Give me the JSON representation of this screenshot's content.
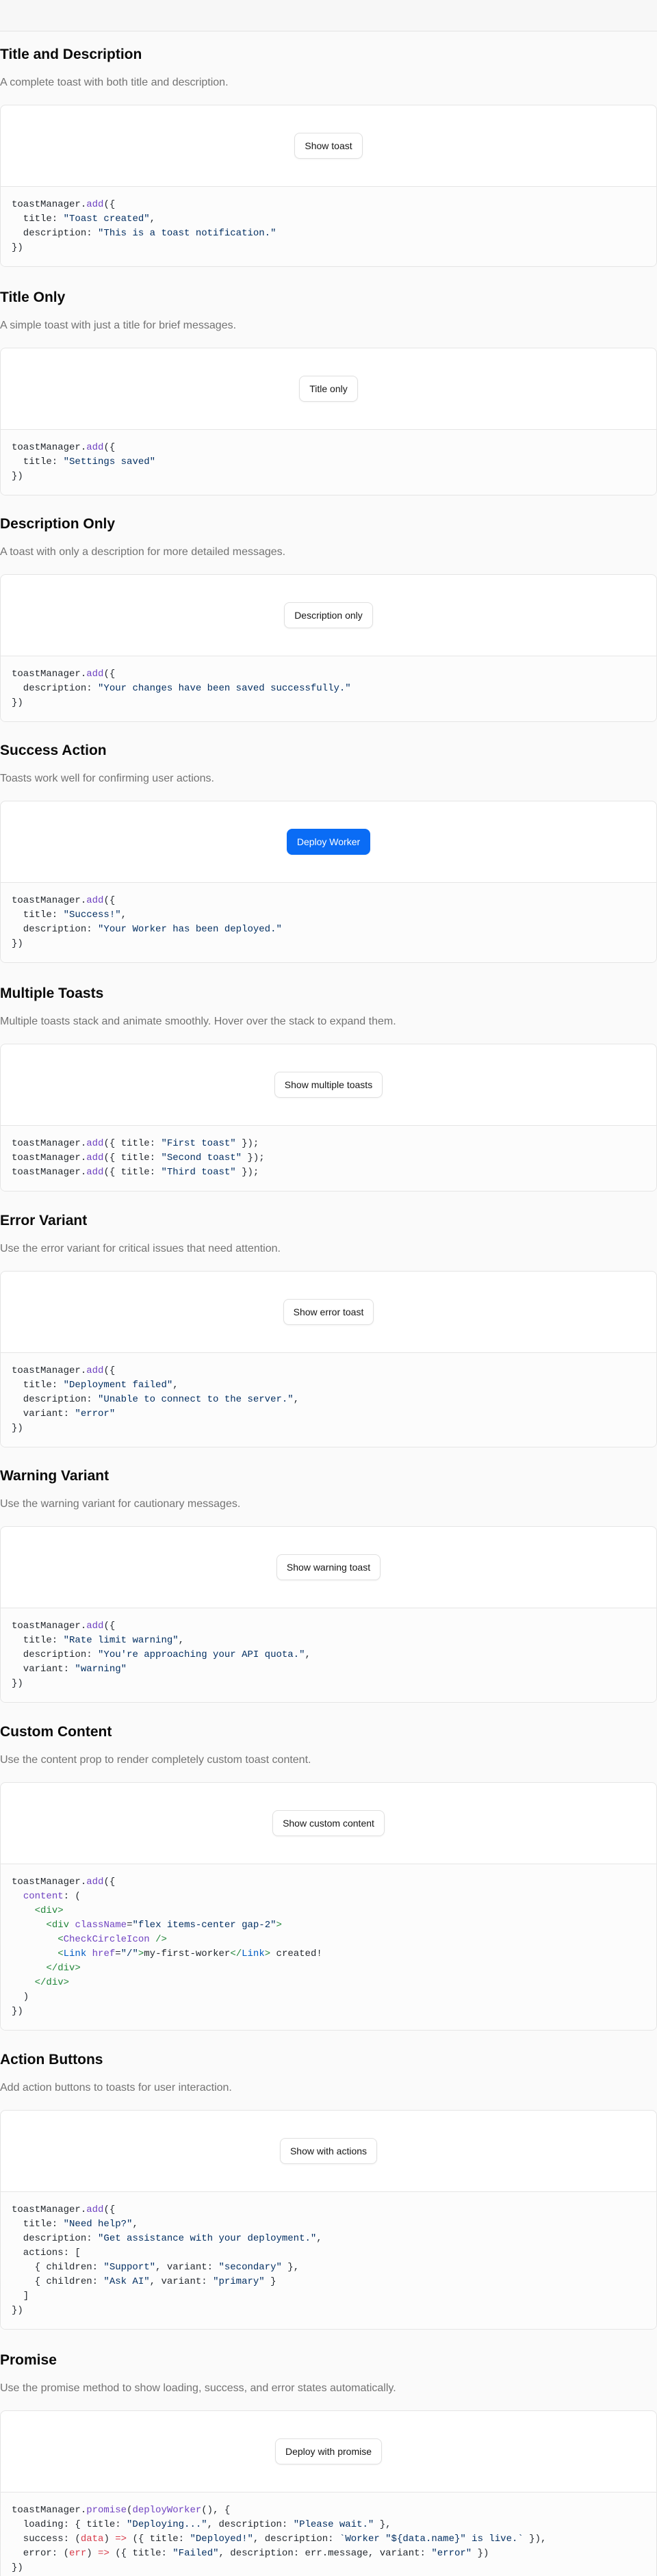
{
  "sections": [
    {
      "title": "Title and Description",
      "description": "A complete toast with both title and description.",
      "button": "Show toast",
      "primary": false,
      "code": [
        [
          [
            "plain",
            "toastManager."
          ],
          [
            "fn",
            "add"
          ],
          [
            "plain",
            "({"
          ]
        ],
        [
          [
            "plain",
            "  title: "
          ],
          [
            "str",
            "\"Toast created\""
          ],
          [
            "plain",
            ","
          ]
        ],
        [
          [
            "plain",
            "  description: "
          ],
          [
            "str",
            "\"This is a toast notification.\""
          ]
        ],
        [
          [
            "plain",
            "})"
          ]
        ]
      ]
    },
    {
      "title": "Title Only",
      "description": "A simple toast with just a title for brief messages.",
      "button": "Title only",
      "primary": false,
      "code": [
        [
          [
            "plain",
            "toastManager."
          ],
          [
            "fn",
            "add"
          ],
          [
            "plain",
            "({"
          ]
        ],
        [
          [
            "plain",
            "  title: "
          ],
          [
            "str",
            "\"Settings saved\""
          ]
        ],
        [
          [
            "plain",
            "})"
          ]
        ]
      ]
    },
    {
      "title": "Description Only",
      "description": "A toast with only a description for more detailed messages.",
      "button": "Description only",
      "primary": false,
      "code": [
        [
          [
            "plain",
            "toastManager."
          ],
          [
            "fn",
            "add"
          ],
          [
            "plain",
            "({"
          ]
        ],
        [
          [
            "plain",
            "  description: "
          ],
          [
            "str",
            "\"Your changes have been saved successfully.\""
          ]
        ],
        [
          [
            "plain",
            "})"
          ]
        ]
      ]
    },
    {
      "title": "Success Action",
      "description": "Toasts work well for confirming user actions.",
      "button": "Deploy Worker",
      "primary": true,
      "code": [
        [
          [
            "plain",
            "toastManager."
          ],
          [
            "fn",
            "add"
          ],
          [
            "plain",
            "({"
          ]
        ],
        [
          [
            "plain",
            "  title: "
          ],
          [
            "str",
            "\"Success!\""
          ],
          [
            "plain",
            ","
          ]
        ],
        [
          [
            "plain",
            "  description: "
          ],
          [
            "str",
            "\"Your Worker has been deployed.\""
          ]
        ],
        [
          [
            "plain",
            "})"
          ]
        ]
      ]
    },
    {
      "title": "Multiple Toasts",
      "description": "Multiple toasts stack and animate smoothly. Hover over the stack to expand them.",
      "button": "Show multiple toasts",
      "primary": false,
      "code": [
        [
          [
            "plain",
            "toastManager."
          ],
          [
            "fn",
            "add"
          ],
          [
            "plain",
            "({ title: "
          ],
          [
            "str",
            "\"First toast\""
          ],
          [
            "plain",
            " });"
          ]
        ],
        [
          [
            "plain",
            "toastManager."
          ],
          [
            "fn",
            "add"
          ],
          [
            "plain",
            "({ title: "
          ],
          [
            "str",
            "\"Second toast\""
          ],
          [
            "plain",
            " });"
          ]
        ],
        [
          [
            "plain",
            "toastManager."
          ],
          [
            "fn",
            "add"
          ],
          [
            "plain",
            "({ title: "
          ],
          [
            "str",
            "\"Third toast\""
          ],
          [
            "plain",
            " });"
          ]
        ]
      ]
    },
    {
      "title": "Error Variant",
      "description": "Use the error variant for critical issues that need attention.",
      "button": "Show error toast",
      "primary": false,
      "code": [
        [
          [
            "plain",
            "toastManager."
          ],
          [
            "fn",
            "add"
          ],
          [
            "plain",
            "({"
          ]
        ],
        [
          [
            "plain",
            "  title: "
          ],
          [
            "str",
            "\"Deployment failed\""
          ],
          [
            "plain",
            ","
          ]
        ],
        [
          [
            "plain",
            "  description: "
          ],
          [
            "str",
            "\"Unable to connect to the server.\""
          ],
          [
            "plain",
            ","
          ]
        ],
        [
          [
            "plain",
            "  variant: "
          ],
          [
            "str",
            "\"error\""
          ]
        ],
        [
          [
            "plain",
            "})"
          ]
        ]
      ]
    },
    {
      "title": "Warning Variant",
      "description": "Use the warning variant for cautionary messages.",
      "button": "Show warning toast",
      "primary": false,
      "code": [
        [
          [
            "plain",
            "toastManager."
          ],
          [
            "fn",
            "add"
          ],
          [
            "plain",
            "({"
          ]
        ],
        [
          [
            "plain",
            "  title: "
          ],
          [
            "str",
            "\"Rate limit warning\""
          ],
          [
            "plain",
            ","
          ]
        ],
        [
          [
            "plain",
            "  description: "
          ],
          [
            "str",
            "\"You're approaching your API quota.\""
          ],
          [
            "plain",
            ","
          ]
        ],
        [
          [
            "plain",
            "  variant: "
          ],
          [
            "str",
            "\"warning\""
          ]
        ],
        [
          [
            "plain",
            "})"
          ]
        ]
      ]
    },
    {
      "title": "Custom Content",
      "description": "Use the content prop to render completely custom toast content.",
      "button": "Show custom content",
      "primary": false,
      "code": [
        [
          [
            "plain",
            "toastManager."
          ],
          [
            "fn",
            "add"
          ],
          [
            "plain",
            "({"
          ]
        ],
        [
          [
            "plain",
            "  "
          ],
          [
            "attr",
            "content"
          ],
          [
            "plain",
            ": ("
          ]
        ],
        [
          [
            "plain",
            "    "
          ],
          [
            "tag",
            "<div>"
          ]
        ],
        [
          [
            "plain",
            "      "
          ],
          [
            "tag",
            "<div"
          ],
          [
            "plain",
            " "
          ],
          [
            "attr",
            "className"
          ],
          [
            "plain",
            "="
          ],
          [
            "str",
            "\"flex items-center gap-2\""
          ],
          [
            "tag",
            ">"
          ]
        ],
        [
          [
            "plain",
            "        "
          ],
          [
            "tag",
            "<"
          ],
          [
            "attr",
            "CheckCircleIcon"
          ],
          [
            "plain",
            " "
          ],
          [
            "tag",
            "/>"
          ]
        ],
        [
          [
            "plain",
            "        "
          ],
          [
            "tag",
            "<"
          ],
          [
            "id",
            "Link"
          ],
          [
            "plain",
            " "
          ],
          [
            "attr",
            "href"
          ],
          [
            "plain",
            "="
          ],
          [
            "str",
            "\"/\""
          ],
          [
            "tag",
            ">"
          ],
          [
            "plain",
            "my-first-worker"
          ],
          [
            "tag",
            "</"
          ],
          [
            "id",
            "Link"
          ],
          [
            "tag",
            ">"
          ],
          [
            "plain",
            " created!"
          ]
        ],
        [
          [
            "plain",
            "      "
          ],
          [
            "tag",
            "</div>"
          ]
        ],
        [
          [
            "plain",
            "    "
          ],
          [
            "tag",
            "</div>"
          ]
        ],
        [
          [
            "plain",
            "  )"
          ]
        ],
        [
          [
            "plain",
            "})"
          ]
        ]
      ]
    },
    {
      "title": "Action Buttons",
      "description": "Add action buttons to toasts for user interaction.",
      "button": "Show with actions",
      "primary": false,
      "code": [
        [
          [
            "plain",
            "toastManager."
          ],
          [
            "fn",
            "add"
          ],
          [
            "plain",
            "({"
          ]
        ],
        [
          [
            "plain",
            "  title: "
          ],
          [
            "str",
            "\"Need help?\""
          ],
          [
            "plain",
            ","
          ]
        ],
        [
          [
            "plain",
            "  description: "
          ],
          [
            "str",
            "\"Get assistance with your deployment.\""
          ],
          [
            "plain",
            ","
          ]
        ],
        [
          [
            "plain",
            "  actions: ["
          ]
        ],
        [
          [
            "plain",
            "    { children: "
          ],
          [
            "str",
            "\"Support\""
          ],
          [
            "plain",
            ", variant: "
          ],
          [
            "str",
            "\"secondary\""
          ],
          [
            "plain",
            " },"
          ]
        ],
        [
          [
            "plain",
            "    { children: "
          ],
          [
            "str",
            "\"Ask AI\""
          ],
          [
            "plain",
            ", variant: "
          ],
          [
            "str",
            "\"primary\""
          ],
          [
            "plain",
            " }"
          ]
        ],
        [
          [
            "plain",
            "  ]"
          ]
        ],
        [
          [
            "plain",
            "})"
          ]
        ]
      ]
    },
    {
      "title": "Promise",
      "description": "Use the promise method to show loading, success, and error states automatically.",
      "button": "Deploy with promise",
      "primary": false,
      "code": [
        [
          [
            "plain",
            "toastManager."
          ],
          [
            "fn",
            "promise"
          ],
          [
            "plain",
            "("
          ],
          [
            "fn",
            "deployWorker"
          ],
          [
            "plain",
            "(), {"
          ]
        ],
        [
          [
            "plain",
            "  loading: { title: "
          ],
          [
            "str",
            "\"Deploying...\""
          ],
          [
            "plain",
            ", description: "
          ],
          [
            "str",
            "\"Please wait.\""
          ],
          [
            "plain",
            " },"
          ]
        ],
        [
          [
            "plain",
            "  success: ("
          ],
          [
            "kw",
            "data"
          ],
          [
            "plain",
            ") "
          ],
          [
            "kw",
            "=>"
          ],
          [
            "plain",
            " ({ title: "
          ],
          [
            "str",
            "\"Deployed!\""
          ],
          [
            "plain",
            ", description: "
          ],
          [
            "str",
            "`Worker \"${data.name}\" is live.`"
          ],
          [
            "plain",
            " }),"
          ]
        ],
        [
          [
            "plain",
            "  error: ("
          ],
          [
            "kw",
            "err"
          ],
          [
            "plain",
            ") "
          ],
          [
            "kw",
            "=>"
          ],
          [
            "plain",
            " ({ title: "
          ],
          [
            "str",
            "\"Failed\""
          ],
          [
            "plain",
            ", description: err.message, variant: "
          ],
          [
            "str",
            "\"error\""
          ],
          [
            "plain",
            " })"
          ]
        ],
        [
          [
            "plain",
            "})"
          ]
        ]
      ]
    }
  ]
}
